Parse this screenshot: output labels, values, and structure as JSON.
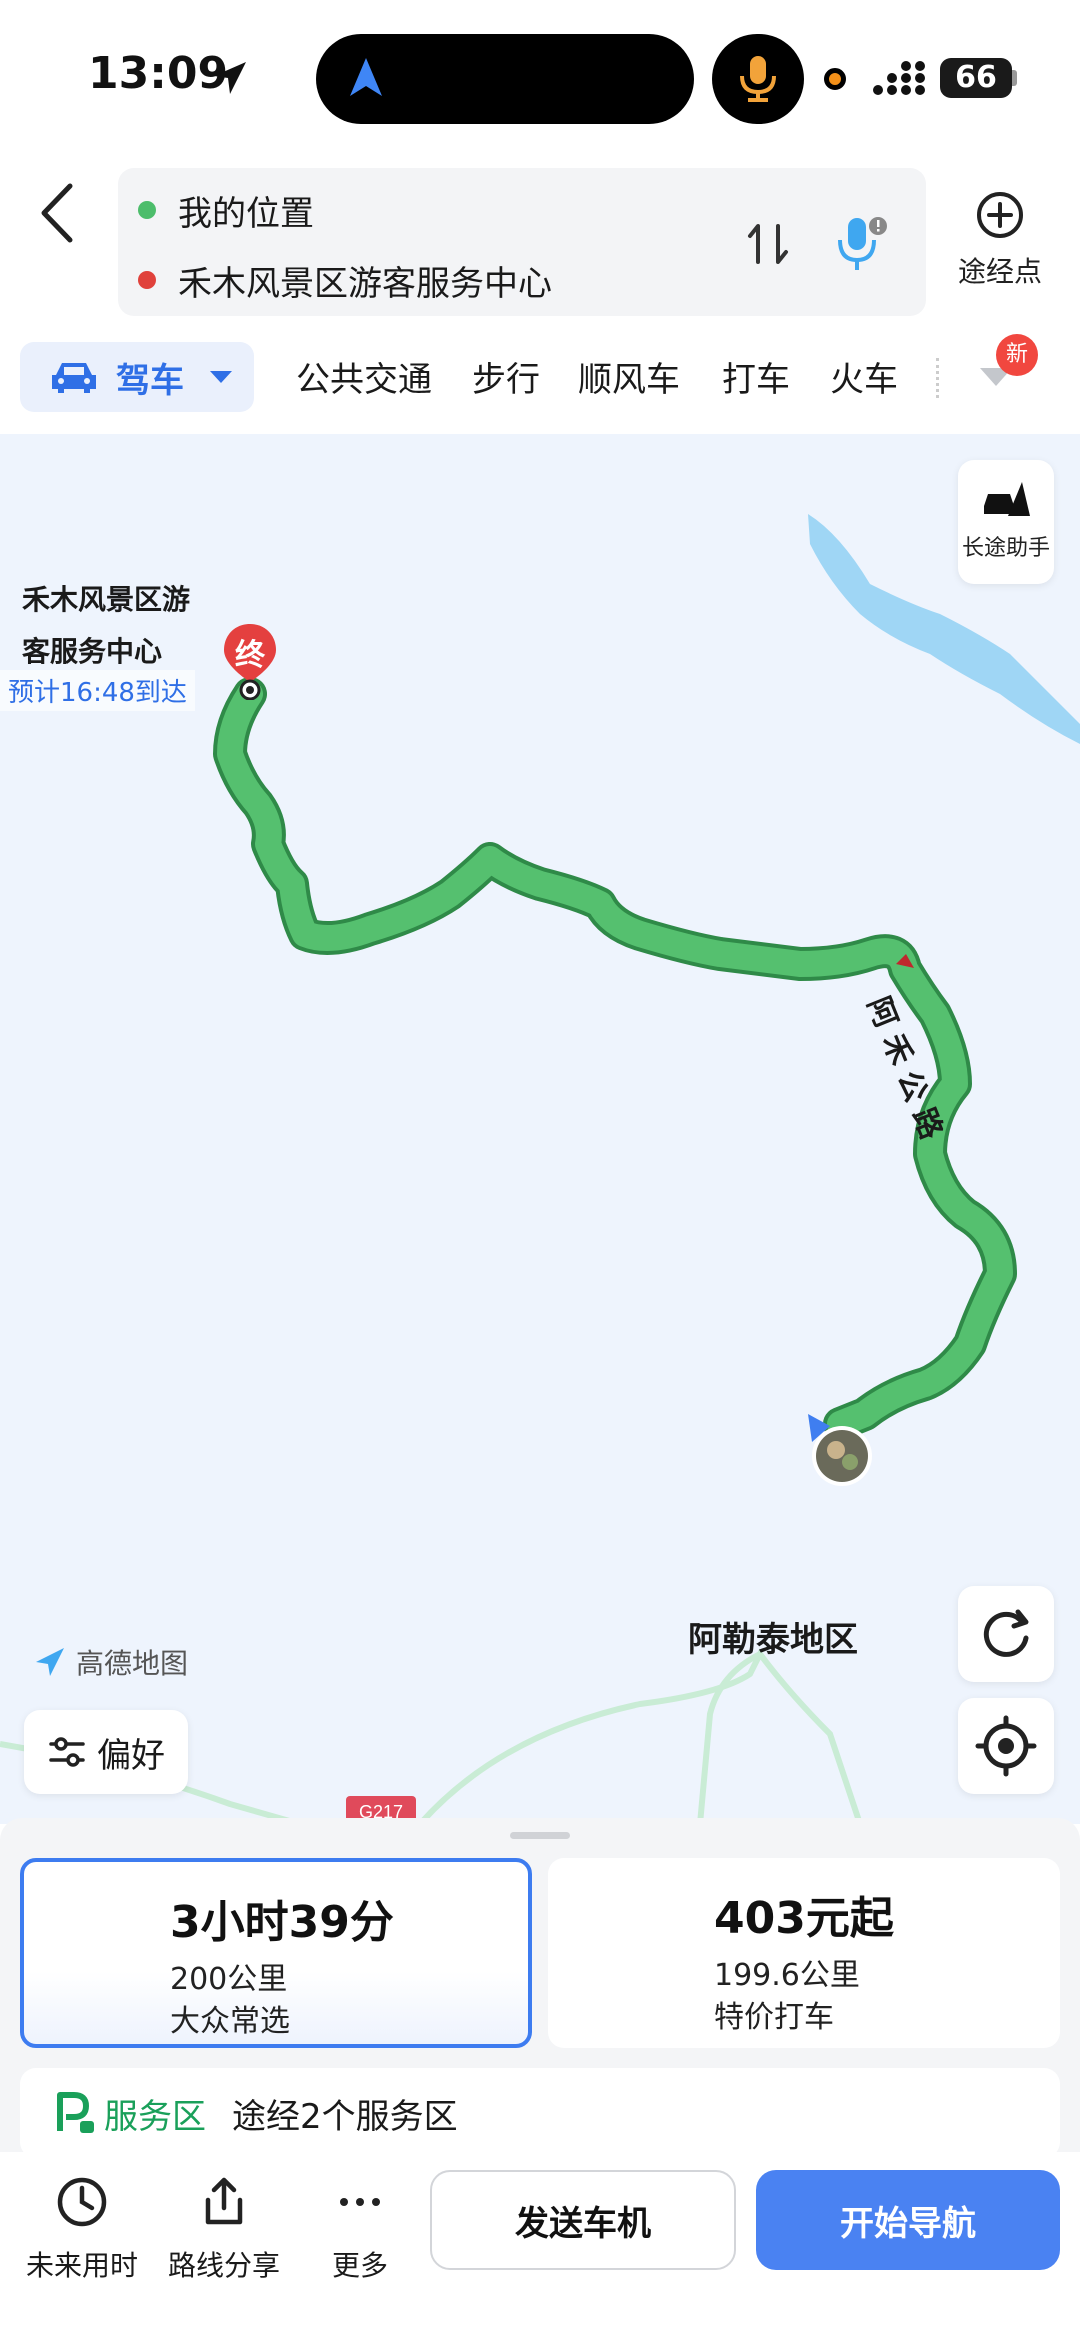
{
  "status": {
    "time": "13:09",
    "battery": "66"
  },
  "header": {
    "origin": "我的位置",
    "destination": "禾木风景区游客服务中心",
    "waypoint_label": "途经点"
  },
  "modes": {
    "selected": "驾车",
    "tabs": [
      "公共交通",
      "步行",
      "顺风车",
      "打车",
      "火车"
    ],
    "new_badge": "新"
  },
  "map": {
    "dest_name_line1": "禾木风景区游",
    "dest_name_line2": "客服务中心",
    "eta": "预计16:48到达",
    "end_pin": "终",
    "road_name": "阿禾公路",
    "city": "阿勒泰地区",
    "highway": "G217",
    "logo": "高德地图",
    "longtrip_label": "长途助手",
    "preference_label": "偏好"
  },
  "routes": [
    {
      "main": "3小时39分",
      "distance": "200公里",
      "tag": "大众常选",
      "selected": true
    },
    {
      "main": "403元起",
      "distance": "199.6公里",
      "tag": "特价打车",
      "selected": false
    }
  ],
  "service": {
    "title": "服务区",
    "desc": "途经2个服务区"
  },
  "toolbar": {
    "future_time": "未来用时",
    "share": "路线分享",
    "more": "更多",
    "send": "发送车机",
    "start": "开始导航"
  },
  "colors": {
    "accent": "#3d7cf0",
    "route": "#4cbd6b",
    "service": "#1aa05a",
    "badge": "#f1473f"
  }
}
